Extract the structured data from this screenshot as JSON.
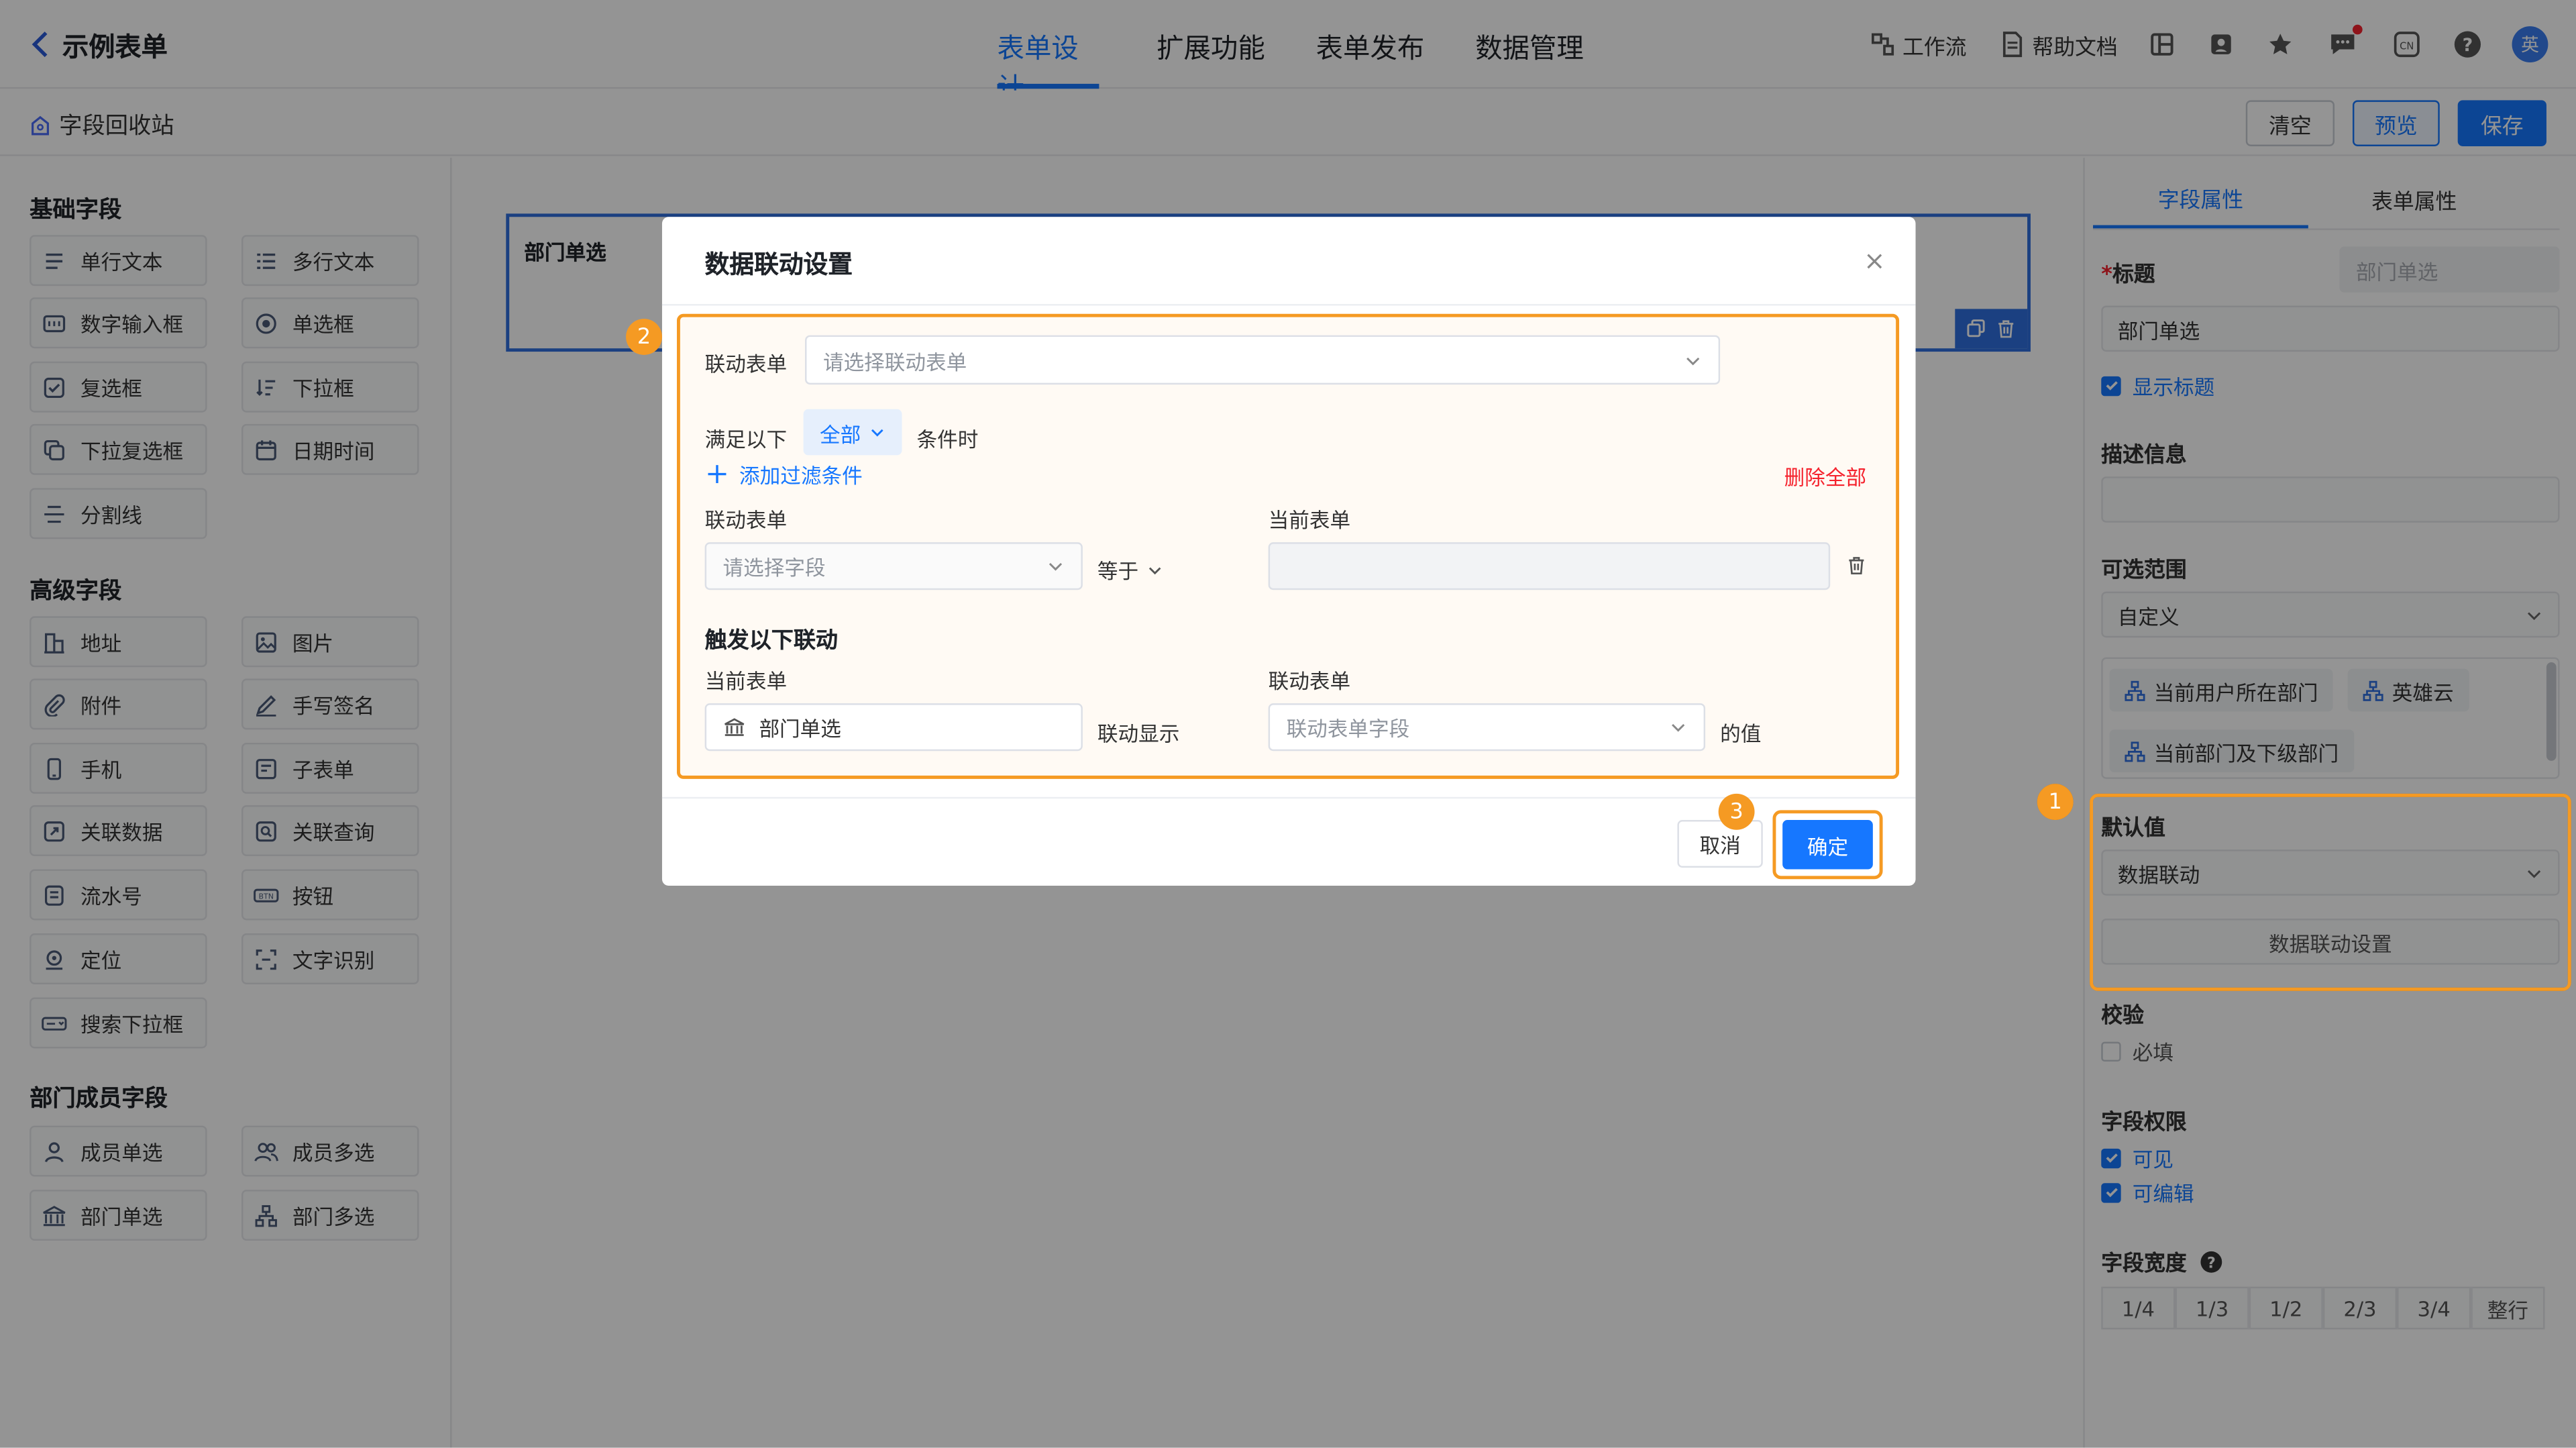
{
  "header": {
    "back_title": "示例表单",
    "tabs": [
      {
        "label": "表单设计",
        "active": true
      },
      {
        "label": "扩展功能",
        "active": false
      },
      {
        "label": "表单发布",
        "active": false
      },
      {
        "label": "数据管理",
        "active": false
      }
    ],
    "tools": {
      "workflow": "工作流",
      "help": "帮助文档"
    },
    "avatar": "英"
  },
  "subbar": {
    "recycle": "字段回收站",
    "clear": "清空",
    "preview": "预览",
    "save": "保存"
  },
  "left": {
    "sections": [
      {
        "title": "基础字段",
        "items": [
          {
            "label": "单行文本",
            "icon": "lines-icon"
          },
          {
            "label": "多行文本",
            "icon": "list-icon"
          },
          {
            "label": "数字输入框",
            "icon": "number-icon"
          },
          {
            "label": "单选框",
            "icon": "radio-icon"
          },
          {
            "label": "复选框",
            "icon": "checkbox-icon"
          },
          {
            "label": "下拉框",
            "icon": "sort-icon"
          },
          {
            "label": "下拉复选框",
            "icon": "dropdown-multi-icon"
          },
          {
            "label": "日期时间",
            "icon": "calendar-icon"
          },
          {
            "label": "分割线",
            "icon": "divider-icon"
          }
        ]
      },
      {
        "title": "高级字段",
        "items": [
          {
            "label": "地址",
            "icon": "address-icon"
          },
          {
            "label": "图片",
            "icon": "image-icon"
          },
          {
            "label": "附件",
            "icon": "attachment-icon"
          },
          {
            "label": "手写签名",
            "icon": "signature-icon"
          },
          {
            "label": "手机",
            "icon": "phone-icon"
          },
          {
            "label": "子表单",
            "icon": "subform-icon"
          },
          {
            "label": "关联数据",
            "icon": "link-data-icon"
          },
          {
            "label": "关联查询",
            "icon": "link-query-icon"
          },
          {
            "label": "流水号",
            "icon": "serial-icon"
          },
          {
            "label": "按钮",
            "icon": "button-icon"
          },
          {
            "label": "定位",
            "icon": "location-icon"
          },
          {
            "label": "文字识别",
            "icon": "ocr-icon"
          },
          {
            "label": "搜索下拉框",
            "icon": "search-dropdown-icon"
          }
        ]
      },
      {
        "title": "部门成员字段",
        "items": [
          {
            "label": "成员单选",
            "icon": "user-icon"
          },
          {
            "label": "成员多选",
            "icon": "users-icon"
          },
          {
            "label": "部门单选",
            "icon": "building-icon"
          },
          {
            "label": "部门多选",
            "icon": "org-icon"
          }
        ]
      }
    ]
  },
  "canvas": {
    "card_title": "部门单选"
  },
  "right": {
    "tabs": [
      "字段属性",
      "表单属性"
    ],
    "title_label": "标题",
    "title_placeholder": "部门单选",
    "title_value": "部门单选",
    "show_title": "显示标题",
    "desc_label": "描述信息",
    "range_label": "可选范围",
    "range_value": "自定义",
    "range_chips": [
      "当前用户所在部门",
      "英雄云",
      "当前部门及下级部门"
    ],
    "default_label": "默认值",
    "default_value": "数据联动",
    "linkage_button": "数据联动设置",
    "validate_label": "校验",
    "required": "必填",
    "perm_label": "字段权限",
    "visible": "可见",
    "editable": "可编辑",
    "width_label": "字段宽度",
    "widths": [
      "1/4",
      "1/3",
      "1/2",
      "2/3",
      "3/4",
      "整行"
    ]
  },
  "modal": {
    "title": "数据联动设置",
    "link_form_label": "联动表单",
    "link_form_placeholder": "请选择联动表单",
    "cond_prefix": "满足以下",
    "cond_mode": "全部",
    "cond_suffix": "条件时",
    "add_filter": "添加过滤条件",
    "delete_all": "删除全部",
    "filter_left_label": "联动表单",
    "filter_right_label": "当前表单",
    "field_placeholder": "请选择字段",
    "operator": "等于",
    "trigger_title": "触发以下联动",
    "trig_left_label": "当前表单",
    "trig_right_label": "联动表单",
    "current_field": "部门单选",
    "link_show": "联动显示",
    "link_field_placeholder": "联动表单字段",
    "value_suffix": "的值",
    "cancel": "取消",
    "confirm": "确定"
  },
  "callouts": [
    "1",
    "2",
    "3"
  ],
  "colors": {
    "primary": "#1677ff",
    "callout": "#f59a23",
    "danger": "#f5222d"
  }
}
